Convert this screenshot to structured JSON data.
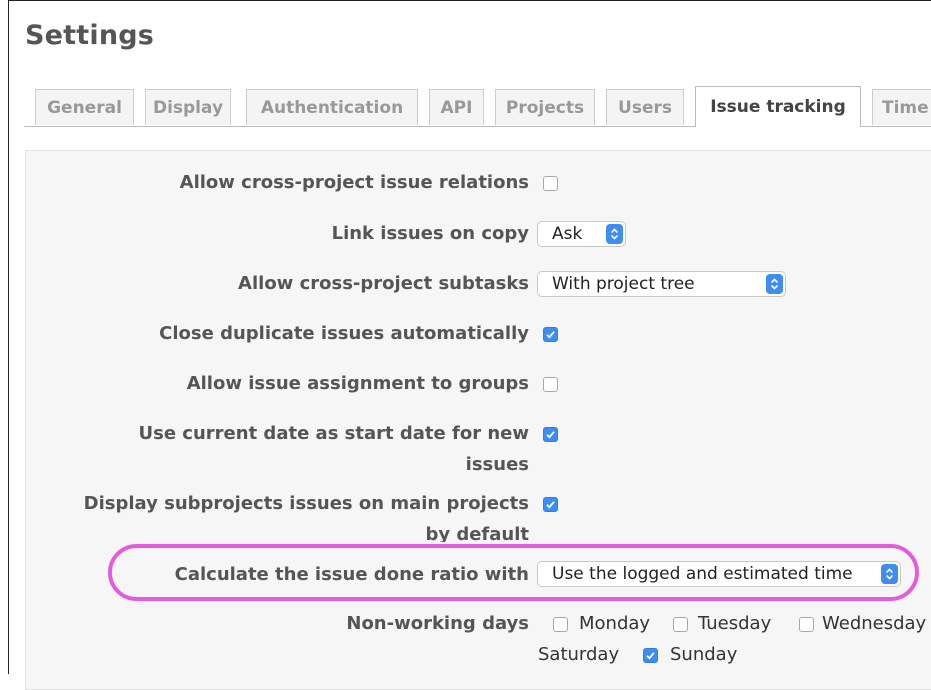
{
  "page": {
    "title": "Settings"
  },
  "tabs": [
    {
      "label": "General",
      "selected": false
    },
    {
      "label": "Display",
      "selected": false
    },
    {
      "label": "Authentication",
      "selected": false
    },
    {
      "label": "API",
      "selected": false
    },
    {
      "label": "Projects",
      "selected": false
    },
    {
      "label": "Users",
      "selected": false
    },
    {
      "label": "Issue tracking",
      "selected": true
    },
    {
      "label": "Time",
      "selected": false
    }
  ],
  "settings": {
    "cross_project_relations": {
      "label": "Allow cross-project issue relations",
      "checked": false
    },
    "link_on_copy": {
      "label": "Link issues on copy",
      "value": "Ask"
    },
    "cross_project_subtasks": {
      "label": "Allow cross-project subtasks",
      "value": "With project tree"
    },
    "close_duplicates": {
      "label": "Close duplicate issues automatically",
      "checked": true
    },
    "assign_to_groups": {
      "label": "Allow issue assignment to groups",
      "checked": false
    },
    "current_date_start": {
      "label": "Use current date as start date for new issues",
      "checked": true
    },
    "subprojects_issues": {
      "label": "Display subprojects issues on main projects by default",
      "checked": true
    },
    "done_ratio": {
      "label": "Calculate the issue done ratio with",
      "value": "Use the logged and estimated time"
    },
    "non_working_days": {
      "label": "Non-working days",
      "days": [
        {
          "label": "Monday",
          "checked": false
        },
        {
          "label": "Tuesday",
          "checked": false
        },
        {
          "label": "Wednesday",
          "checked": false
        },
        {
          "label": "Saturday",
          "checked": false
        },
        {
          "label": "Sunday",
          "checked": true
        }
      ]
    }
  },
  "colors": {
    "accent": "#3d8ef0",
    "highlight": "#e35ce0"
  }
}
